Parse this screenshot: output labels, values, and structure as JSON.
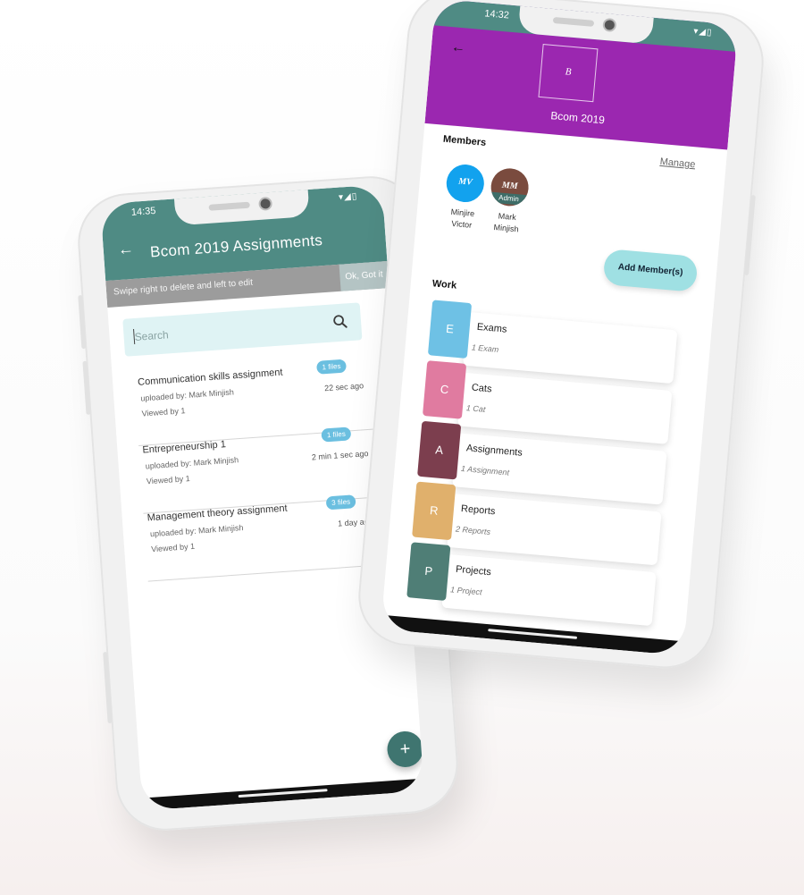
{
  "phone_a": {
    "status_time": "14:35",
    "status_icons": "▾◢▯",
    "back_icon": "←",
    "title": "Bcom 2019 Assignments",
    "snackbar": {
      "message": "Swipe right to delete and left to edit",
      "action": "Ok, Got it"
    },
    "search": {
      "placeholder": "Search"
    },
    "assignments": [
      {
        "title": "Communication skills assignment",
        "uploaded_by": "uploaded by: Mark Minjish",
        "viewed": "Viewed by 1",
        "files": "1 files",
        "ago": "22 sec ago"
      },
      {
        "title": "Entrepreneurship 1",
        "uploaded_by": "uploaded by: Mark Minjish",
        "viewed": "Viewed by 1",
        "files": "1 files",
        "ago": "2 min 1 sec ago"
      },
      {
        "title": "Management theory assignment",
        "uploaded_by": "uploaded by: Mark Minjish",
        "viewed": "Viewed by 1",
        "files": "3 files",
        "ago": "1 day ago"
      }
    ],
    "fab_label": "+"
  },
  "phone_b": {
    "status_time": "14:32",
    "status_icons": "▾◢▯",
    "back_icon": "←",
    "group_initial": "B",
    "group_name": "Bcom 2019",
    "members_heading": "Members",
    "manage_link": "Manage",
    "members": [
      {
        "initials": "MV",
        "name_line1": "Minjire",
        "name_line2": "Victor",
        "color": "#12a2ee"
      },
      {
        "initials": "MM",
        "name_line1": "Mark",
        "name_line2": "Minjish",
        "color": "#7a4b3e",
        "badge": "Admin"
      }
    ],
    "add_members_button": "Add Member(s)",
    "work_heading": "Work",
    "work_items": [
      {
        "letter": "E",
        "title": "Exams",
        "count": "1 Exam",
        "color": "#6ec1e5"
      },
      {
        "letter": "C",
        "title": "Cats",
        "count": "1 Cat",
        "color": "#e07ba0"
      },
      {
        "letter": "A",
        "title": "Assignments",
        "count": "1 Assignment",
        "color": "#7c3e4e"
      },
      {
        "letter": "R",
        "title": "Reports",
        "count": "2 Reports",
        "color": "#e0b06c"
      },
      {
        "letter": "P",
        "title": "Projects",
        "count": "1 Project",
        "color": "#4f7e76"
      }
    ]
  },
  "colors": {
    "teal": "#4f8b84",
    "purple": "#9b27b0",
    "search_bg": "#dff3f4",
    "badge_blue": "#6bbfe0"
  }
}
